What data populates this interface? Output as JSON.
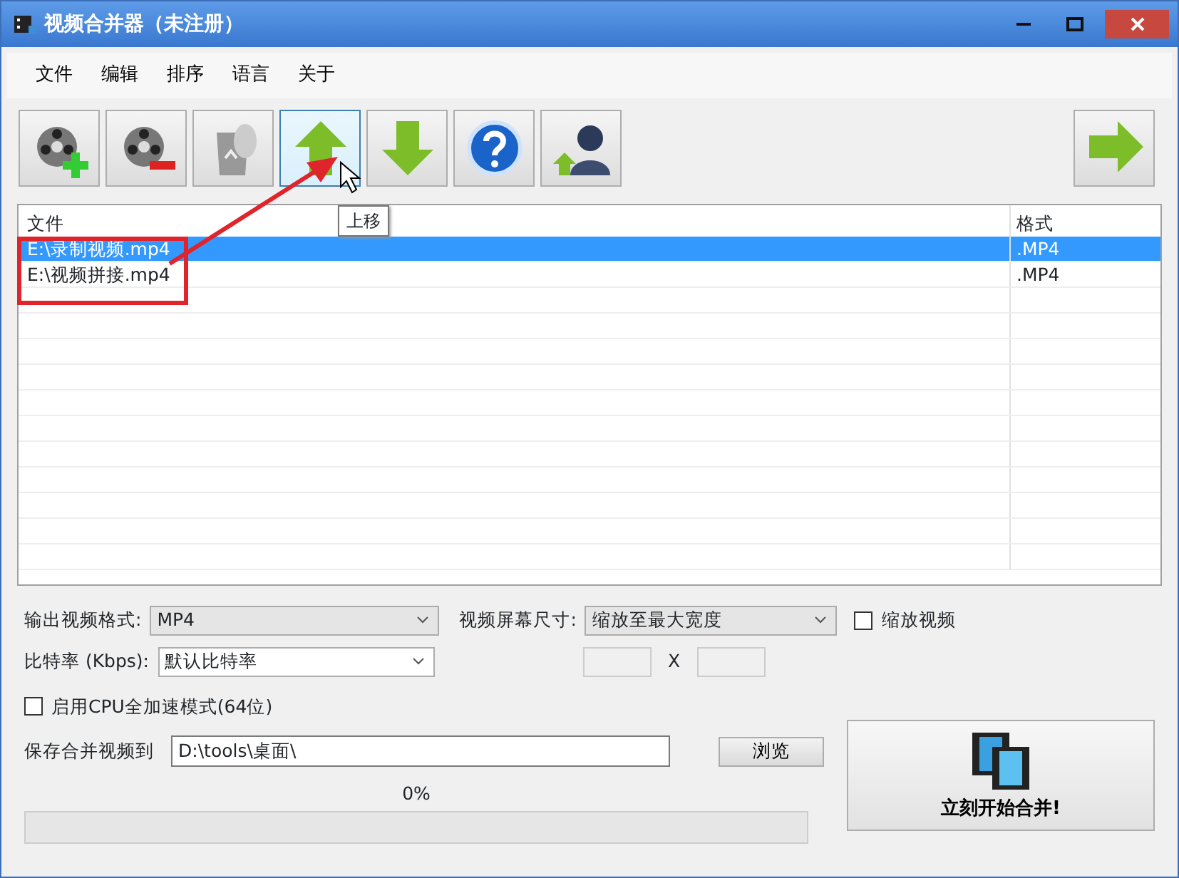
{
  "window": {
    "title": "视频合并器（未注册）"
  },
  "menu": [
    "文件",
    "编辑",
    "排序",
    "语言",
    "关于"
  ],
  "toolbar": [
    {
      "kind": "add-video",
      "hovered": false
    },
    {
      "kind": "remove-video",
      "hovered": false
    },
    {
      "kind": "trash",
      "hovered": false
    },
    {
      "kind": "up",
      "hovered": true
    },
    {
      "kind": "down",
      "hovered": false
    },
    {
      "kind": "help",
      "hovered": false
    },
    {
      "kind": "user-up",
      "hovered": false
    }
  ],
  "next_button": {
    "kind": "forward"
  },
  "tooltip": "上移",
  "table": {
    "columns": [
      "文件",
      "格式"
    ],
    "rows": [
      {
        "cells": [
          "E:\\录制视频.mp4",
          ".MP4"
        ],
        "selected": true
      },
      {
        "cells": [
          "E:\\视频拼接.mp4",
          ".MP4"
        ],
        "selected": false
      }
    ]
  },
  "output_format": {
    "label": "输出视频格式:",
    "value": "MP4"
  },
  "screen_size": {
    "label": "视频屏幕尺寸:",
    "value": "缩放至最大宽度"
  },
  "scale_video": {
    "label": "缩放视频",
    "checked": false
  },
  "bitrate": {
    "label": "比特率 (Kbps):",
    "value": "默认比特率"
  },
  "size_separator": "X",
  "cpu_mode": {
    "label": "启用CPU全加速模式(64位)",
    "checked": false
  },
  "save_to": {
    "label": "保存合并视频到",
    "value": "D:\\tools\\桌面\\",
    "browse": "浏览"
  },
  "progress": {
    "text": "0%",
    "level": 0
  },
  "start_button": "立刻开始合并!"
}
